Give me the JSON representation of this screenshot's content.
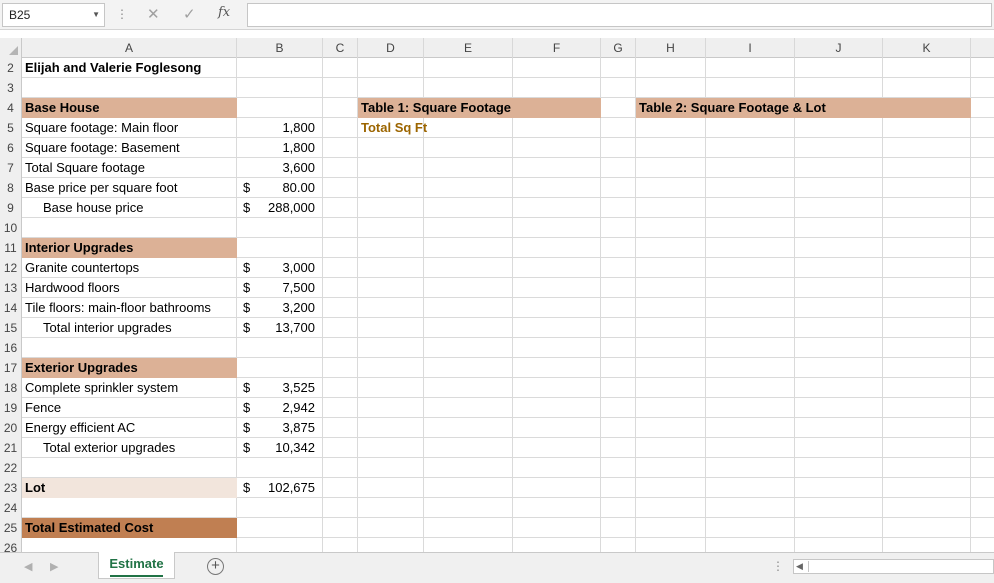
{
  "formula_bar": {
    "name_box": "B25",
    "name_box_arrow": "▼",
    "dots": "⋮",
    "cancel_icon": "✕",
    "enter_icon": "✓",
    "fx_label": "fx",
    "formula_value": ""
  },
  "columns": [
    "A",
    "B",
    "C",
    "D",
    "E",
    "F",
    "G",
    "H",
    "I",
    "J",
    "K"
  ],
  "rows": {
    "r2": {
      "num": "2",
      "A": "Elijah and Valerie Foglesong"
    },
    "r3": {
      "num": "3"
    },
    "r4": {
      "num": "4",
      "A": "Base House",
      "D": "Table 1: Square Footage",
      "H": "Table 2: Square Footage & Lot"
    },
    "r5": {
      "num": "5",
      "A": "Square footage: Main floor",
      "B": "1,800",
      "D": "Total Sq Ft"
    },
    "r6": {
      "num": "6",
      "A": "Square footage: Basement",
      "B": "1,800"
    },
    "r7": {
      "num": "7",
      "A": "Total Square footage",
      "B": "3,600"
    },
    "r8": {
      "num": "8",
      "A": "Base price per square foot",
      "B_cur": "$",
      "B": "80.00"
    },
    "r9": {
      "num": "9",
      "A": "Base house price",
      "B_cur": "$",
      "B": "288,000"
    },
    "r10": {
      "num": "10"
    },
    "r11": {
      "num": "11",
      "A": "Interior Upgrades"
    },
    "r12": {
      "num": "12",
      "A": "Granite countertops",
      "B_cur": "$",
      "B": "3,000"
    },
    "r13": {
      "num": "13",
      "A": "Hardwood floors",
      "B_cur": "$",
      "B": "7,500"
    },
    "r14": {
      "num": "14",
      "A": "Tile floors: main-floor bathrooms",
      "B_cur": "$",
      "B": "3,200"
    },
    "r15": {
      "num": "15",
      "A": "Total interior upgrades",
      "B_cur": "$",
      "B": "13,700"
    },
    "r16": {
      "num": "16"
    },
    "r17": {
      "num": "17",
      "A": "Exterior Upgrades"
    },
    "r18": {
      "num": "18",
      "A": "Complete sprinkler system",
      "B_cur": "$",
      "B": "3,525"
    },
    "r19": {
      "num": "19",
      "A": "Fence",
      "B_cur": "$",
      "B": "2,942"
    },
    "r20": {
      "num": "20",
      "A": "Energy efficient AC",
      "B_cur": "$",
      "B": "3,875"
    },
    "r21": {
      "num": "21",
      "A": "Total exterior upgrades",
      "B_cur": "$",
      "B": "10,342"
    },
    "r22": {
      "num": "22"
    },
    "r23": {
      "num": "23",
      "A": "Lot",
      "B_cur": "$",
      "B": "102,675"
    },
    "r24": {
      "num": "24"
    },
    "r25": {
      "num": "25",
      "A": "Total Estimated Cost"
    },
    "r26": {
      "num": "26"
    }
  },
  "sheet_tabs": {
    "prev_icon": "◀",
    "next_icon": "▶",
    "active_tab": "Estimate",
    "add_sheet_icon": "+",
    "dots": "⋮",
    "scroll_left_icon": "◀"
  },
  "colors": {
    "section_fill": "#dcb196",
    "lot_fill": "#f2e5dc",
    "total_fill": "#c07f52",
    "accent_green": "#217346",
    "total_sq_ft_text": "#9c6500"
  }
}
